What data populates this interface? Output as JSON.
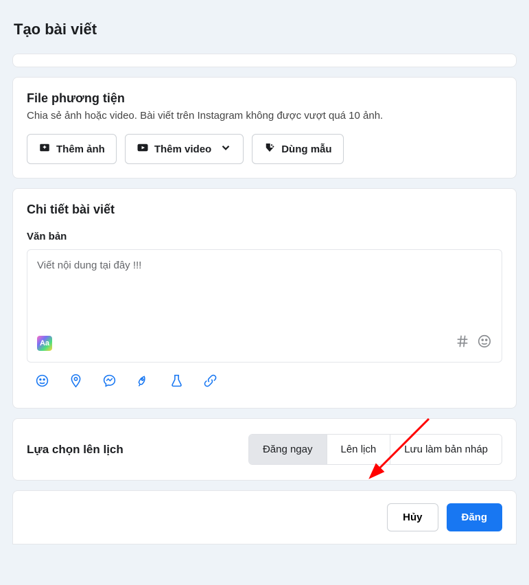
{
  "page_title": "Tạo bài viết",
  "media": {
    "title": "File phương tiện",
    "desc": "Chia sẻ ảnh hoặc video. Bài viết trên Instagram không được vượt quá 10 ảnh.",
    "add_photo": "Thêm ảnh",
    "add_video": "Thêm video",
    "use_template": "Dùng mẫu"
  },
  "details": {
    "title": "Chi tiết bài viết",
    "text_label": "Văn bản",
    "placeholder": "Viết nội dung tại đây !!!"
  },
  "schedule": {
    "title": "Lựa chọn lên lịch",
    "options": {
      "now": "Đăng ngay",
      "schedule": "Lên lịch",
      "draft": "Lưu làm bản nháp"
    }
  },
  "footer": {
    "cancel": "Hủy",
    "publish": "Đăng"
  }
}
